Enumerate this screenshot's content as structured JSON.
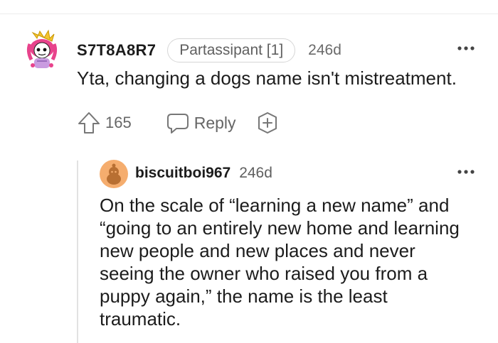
{
  "comment": {
    "username": "S7T8A8R7",
    "flair": "Partassipant [1]",
    "age": "246d",
    "body": "Yta, changing a dogs name isn't mistreatment.",
    "upvotes": "165",
    "reply_label": "Reply",
    "more_icon": "ellipsis-icon",
    "avatar_icon": "pink-snoo-avatar"
  },
  "reply": {
    "username": "biscuitboi967",
    "age": "246d",
    "body_lines": [
      "On the scale of “learning a new name” and",
      "“going to an entirely new home and learning",
      "new people and new places and never",
      "seeing the owner who raised you from a",
      "puppy again,” the name is the least",
      "traumatic."
    ],
    "more_icon": "ellipsis-icon",
    "avatar_icon": "orange-snoo-avatar"
  },
  "colors": {
    "text": "#1c1c1c",
    "muted": "#666666",
    "divider": "#e2e2e2",
    "avatar2_bg": "#f5ad6e"
  }
}
